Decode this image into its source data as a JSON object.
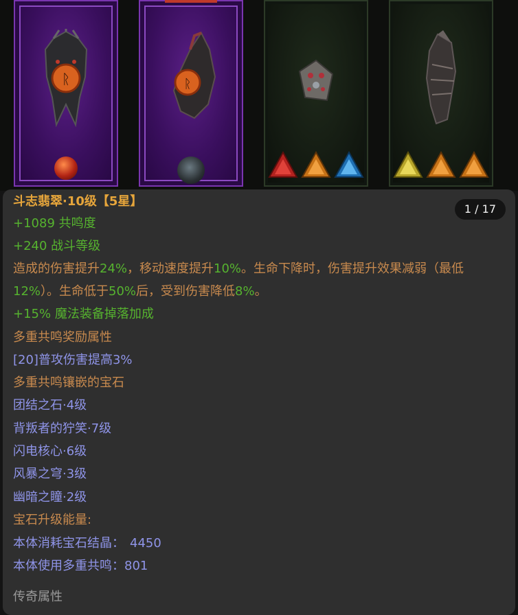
{
  "slots": [
    {
      "name": "helmet",
      "icon": "dark-helmet-with-rune-icon",
      "socket": "red-orb-gem-icon",
      "frame": "purple"
    },
    {
      "name": "shoulder",
      "icon": "dark-pauldron-with-rune-icon",
      "socket": "dark-orb-gem-icon",
      "frame": "purple"
    },
    {
      "name": "jewel",
      "icon": "square-jewel-icon",
      "gems": [
        "red-triangle-gem-icon",
        "orange-triangle-gem-icon",
        "blue-triangle-gem-icon"
      ],
      "frame": "green"
    },
    {
      "name": "gauntlet",
      "icon": "gauntlet-icon",
      "gems": [
        "yellow-triangle-gem-icon",
        "orange-triangle-gem-icon",
        "orange-triangle-gem-icon"
      ],
      "frame": "green"
    }
  ],
  "panel": {
    "page": "1 / 17",
    "title_name": "斗志翡翠·10级",
    "title_star": "【5星】",
    "stat1_prefix": "+",
    "stat1_value": "1089",
    "stat1_label": " 共鸣度",
    "stat2_prefix": "+",
    "stat2_value": "240",
    "stat2_label": " 战斗等级",
    "desc": {
      "p1": "造成的伤害提升",
      "v1": "24%",
      "p2": "，移动速度提升",
      "v2": "10%",
      "p3": "。生命下降时，伤害提升效果减弱（最低",
      "v3": "12%",
      "p4": "）。生命低于",
      "v4": "50%",
      "p5": "后，受到伤害降低",
      "v5": "8%",
      "p6": "。"
    },
    "stat3_prefix": "+",
    "stat3_value": "15%",
    "stat3_label": " 魔法装备掉落加成",
    "resonance_header": "多重共鸣奖励属性",
    "resonance_bonus": "[20]普攻伤害提高3%",
    "socket_header": "多重共鸣镶嵌的宝石",
    "gems": [
      "团结之石·4级",
      "背叛者的狞笑·7级",
      "闪电核心·6级",
      "风暴之穹·3级",
      "幽暗之瞳·2级"
    ],
    "energy_header": "宝石升级能量:",
    "energy1_label": "本体消耗宝石结晶：",
    "energy1_value": "4450",
    "energy2_label": "本体使用多重共鸣：",
    "energy2_value": "801",
    "legend_header": "传奇属性"
  },
  "colors": {
    "panel_bg": "#2f2f2f",
    "title": "#e6a53b",
    "stat_green": "#56b32f",
    "desc_orange": "#c88a4e",
    "gem_blue": "#8f94e8"
  }
}
